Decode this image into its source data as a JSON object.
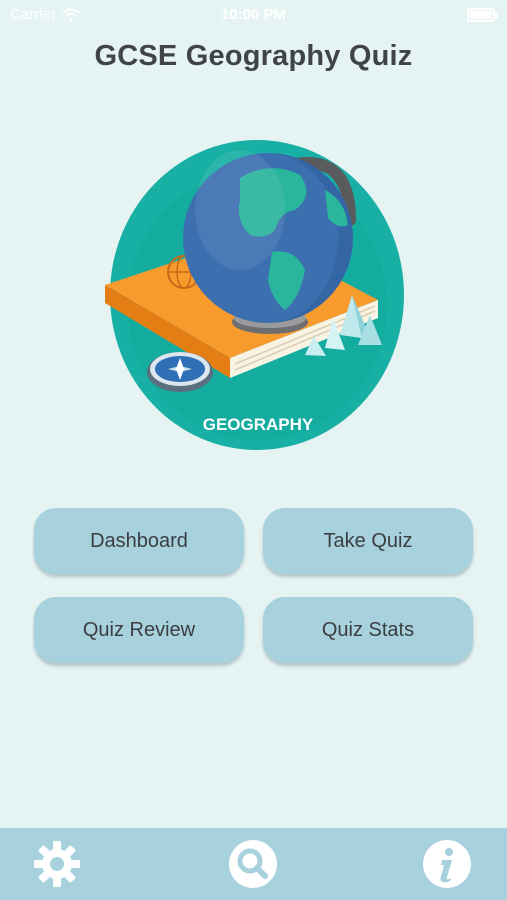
{
  "status_bar": {
    "carrier": "Carrier",
    "time": "10:00 PM",
    "icons": [
      "wifi-icon",
      "battery-icon"
    ]
  },
  "header": {
    "title": "GCSE Geography Quiz"
  },
  "hero": {
    "badge_text": "GEOGRAPHY",
    "colors": {
      "circle": "#18b0a4",
      "book": "#f39325",
      "globe": "#3c6fb0",
      "land": "#2ab59d"
    }
  },
  "menu": {
    "dashboard_label": "Dashboard",
    "take_quiz_label": "Take Quiz",
    "quiz_review_label": "Quiz Review",
    "quiz_stats_label": "Quiz Stats",
    "button_color": "#a8d1de"
  },
  "tab_bar": {
    "items": [
      {
        "icon": "settings-gear-icon"
      },
      {
        "icon": "search-icon"
      },
      {
        "icon": "info-icon"
      }
    ],
    "background": "#a8d1de"
  }
}
